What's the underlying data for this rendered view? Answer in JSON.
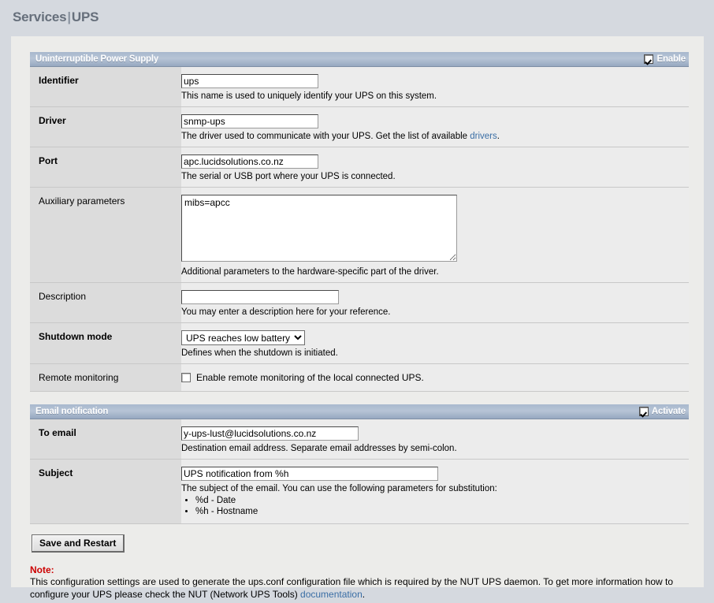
{
  "page": {
    "title_main": "Services",
    "title_sep": "|",
    "title_sub": "UPS"
  },
  "ups_section": {
    "header": "Uninterruptible Power Supply",
    "enable_label": "Enable",
    "enable_checked": true,
    "rows": {
      "identifier": {
        "label": "Identifier",
        "value": "ups",
        "hint": "This name is used to uniquely identify your UPS on this system."
      },
      "driver": {
        "label": "Driver",
        "value": "snmp-ups",
        "hint_before": "The driver used to communicate with your UPS. Get the list of available ",
        "hint_link": "drivers",
        "hint_after": "."
      },
      "port": {
        "label": "Port",
        "value": "apc.lucidsolutions.co.nz",
        "hint": "The serial or USB port where your UPS is connected."
      },
      "auxiliary": {
        "label": "Auxiliary parameters",
        "value": "mibs=apcc",
        "hint": "Additional parameters to the hardware-specific part of the driver."
      },
      "description": {
        "label": "Description",
        "value": "",
        "hint": "You may enter a description here for your reference."
      },
      "shutdown_mode": {
        "label": "Shutdown mode",
        "selected": "UPS reaches low battery",
        "hint": "Defines when the shutdown is initiated."
      },
      "remote_monitoring": {
        "label": "Remote monitoring",
        "checkbox_label": "Enable remote monitoring of the local connected UPS.",
        "checked": false
      }
    }
  },
  "email_section": {
    "header": "Email notification",
    "activate_label": "Activate",
    "activate_checked": true,
    "rows": {
      "to_email": {
        "label": "To email",
        "value": "y-ups-lust@lucidsolutions.co.nz",
        "hint": "Destination email address. Separate email addresses by semi-colon."
      },
      "subject": {
        "label": "Subject",
        "value": "UPS notification from %h",
        "hint": "The subject of the email. You can use the following parameters for substitution:",
        "bullets": [
          "%d - Date",
          "%h - Hostname"
        ]
      }
    }
  },
  "actions": {
    "save_label": "Save and Restart"
  },
  "note": {
    "title": "Note:",
    "text_before": "This configuration settings are used to generate the ups.conf configuration file which is required by the NUT UPS daemon. To get more information how to configure your UPS please check the NUT (Network UPS Tools) ",
    "link": "documentation",
    "text_after": "."
  },
  "colors": {
    "page_background": "#d5d9df",
    "panel_background": "#ececea",
    "section_header": "#a8b8cd",
    "link": "#3a6ea5",
    "note_red": "#cc0000",
    "title_gray": "#666f7b"
  }
}
